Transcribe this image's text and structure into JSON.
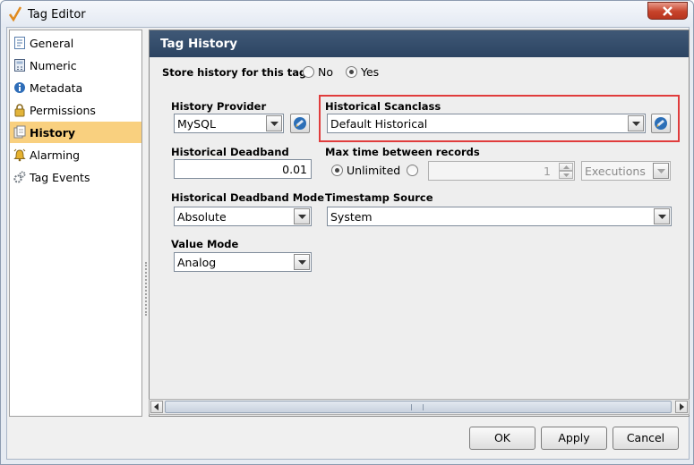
{
  "window": {
    "title": "Tag Editor"
  },
  "nav": {
    "items": [
      {
        "label": "General",
        "icon": "document-icon"
      },
      {
        "label": "Numeric",
        "icon": "numeric-icon"
      },
      {
        "label": "Metadata",
        "icon": "info-icon"
      },
      {
        "label": "Permissions",
        "icon": "lock-icon"
      },
      {
        "label": "History",
        "icon": "history-icon",
        "selected": true
      },
      {
        "label": "Alarming",
        "icon": "bell-icon"
      },
      {
        "label": "Tag Events",
        "icon": "gears-icon"
      }
    ]
  },
  "panel": {
    "title": "Tag History",
    "store_history_label": "Store history for this tag:",
    "store_no": "No",
    "store_yes": "Yes",
    "store_value": "Yes",
    "history_provider": {
      "label": "History Provider",
      "value": "MySQL"
    },
    "historical_scanclass": {
      "label": "Historical Scanclass",
      "value": "Default Historical"
    },
    "historical_deadband": {
      "label": "Historical Deadband",
      "value": "0.01"
    },
    "max_time": {
      "label": "Max time between records",
      "unlimited_label": "Unlimited",
      "selected": "Unlimited",
      "count": "1",
      "unit": "Executions"
    },
    "deadband_mode": {
      "label": "Historical Deadband Mode",
      "value": "Absolute"
    },
    "timestamp_source": {
      "label": "Timestamp Source",
      "value": "System"
    },
    "value_mode": {
      "label": "Value Mode",
      "value": "Analog"
    }
  },
  "buttons": {
    "ok": "OK",
    "apply": "Apply",
    "cancel": "Cancel"
  },
  "colors": {
    "header": "#2c4462",
    "selection": "#f9d07f",
    "highlight": "#e03c3c"
  }
}
